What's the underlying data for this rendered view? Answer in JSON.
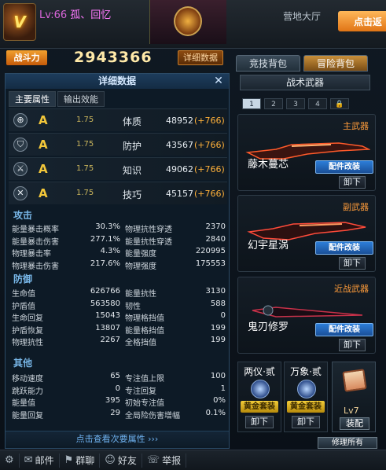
{
  "header": {
    "level": "Lv:66",
    "player_name": "孤、回忆",
    "hall": "营地大厅",
    "click_back": "点击返"
  },
  "power": {
    "label": "战斗力",
    "value": "2943366",
    "detail_button": "详细数据"
  },
  "panel": {
    "title": "详细数据",
    "tabs": [
      "主要属性",
      "输出效能"
    ],
    "attributes": [
      {
        "icon": "crosshair-icon",
        "grade": "A",
        "mult": "1.75",
        "name": "体质",
        "value": "48952",
        "bonus": "(+766)"
      },
      {
        "icon": "shield-icon",
        "grade": "A",
        "mult": "1.75",
        "name": "防护",
        "value": "43567",
        "bonus": "(+766)"
      },
      {
        "icon": "swords-icon",
        "grade": "A",
        "mult": "1.75",
        "name": "知识",
        "value": "49062",
        "bonus": "(+766)"
      },
      {
        "icon": "sword-icon",
        "grade": "A",
        "mult": "1.75",
        "name": "技巧",
        "value": "45157",
        "bonus": "(+766)"
      }
    ],
    "attack": {
      "title": "攻击",
      "rows": [
        [
          "能量暴击概率",
          "30.3%",
          "物理抗性穿透",
          "2370"
        ],
        [
          "能量暴击伤害",
          "277.1%",
          "能量抗性穿透",
          "2840"
        ],
        [
          "物理暴击率",
          "4.3%",
          "能量强度",
          "220995"
        ],
        [
          "物理暴击伤害",
          "217.6%",
          "物理强度",
          "175553"
        ]
      ]
    },
    "defense": {
      "title": "防御",
      "rows": [
        [
          "生命值",
          "626766",
          "能量抗性",
          "3130"
        ],
        [
          "护盾值",
          "563580",
          "韧性",
          "588"
        ],
        [
          "生命回复",
          "15043",
          "物理格挡值",
          "0"
        ],
        [
          "护盾恢复",
          "13807",
          "能量格挡值",
          "199"
        ],
        [
          "物理抗性",
          "2267",
          "全格挡值",
          "199"
        ]
      ]
    },
    "other": {
      "title": "其他",
      "rows": [
        [
          "移动速度",
          "65",
          "专注值上限",
          "100"
        ],
        [
          "跳跃能力",
          "0",
          "专注回复",
          "1"
        ],
        [
          "能量值",
          "395",
          "初始专注值",
          "0%"
        ],
        [
          "能量回复",
          "29",
          "全局险伤害增幅",
          "0.1%"
        ]
      ]
    },
    "more_link": "点击查看次要属性 ›››"
  },
  "right": {
    "tabs": [
      "竞技背包",
      "冒险背包"
    ],
    "sub_title": "战术武器",
    "pages": [
      "1",
      "2",
      "3",
      "4"
    ],
    "main_weapon": {
      "slot": "主武器",
      "name": "藤木蔓芯"
    },
    "sub_weapon": {
      "slot": "副武器",
      "name": "幻宇星涡"
    },
    "melee_weapon": {
      "slot": "近战武器",
      "name": "鬼刃修罗"
    },
    "mod_button": "配件改装",
    "unload_button": "卸下",
    "set1": {
      "title": "两仪·贰",
      "badge": "黄金套装"
    },
    "set2": {
      "title": "万象·贰",
      "badge": "黄金套装"
    },
    "book": {
      "level": "Lv7",
      "equip": "装配"
    },
    "repair_all": "修理所有"
  },
  "bottom": {
    "items": [
      {
        "icon": "gear-icon",
        "label": ""
      },
      {
        "icon": "mail-icon",
        "label": "邮件"
      },
      {
        "icon": "flag-icon",
        "label": "群聊"
      },
      {
        "icon": "friends-icon",
        "label": "好友"
      },
      {
        "icon": "phone-icon",
        "label": "举报"
      }
    ]
  },
  "colors": {
    "accent_orange": "#ffb13a",
    "blue_link": "#6fb2f0"
  }
}
